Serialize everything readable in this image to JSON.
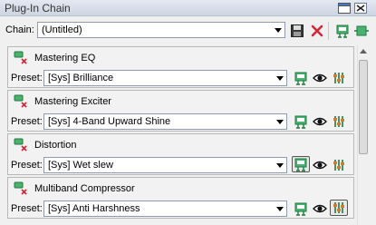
{
  "window": {
    "title": "Plug-In Chain"
  },
  "chain": {
    "label": "Chain:",
    "value": "(Untitled)"
  },
  "plugins": [
    {
      "name": "Mastering EQ",
      "preset_label": "Preset:",
      "preset": "[Sys] Brilliance"
    },
    {
      "name": "Mastering Exciter",
      "preset_label": "Preset:",
      "preset": "[Sys] 4-Band Upward Shine"
    },
    {
      "name": "Distortion",
      "preset_label": "Preset:",
      "preset": "[Sys] Wet slew"
    },
    {
      "name": "Multiband Compressor",
      "preset_label": "Preset:",
      "preset": "[Sys] Anti Harshness"
    }
  ],
  "colors": {
    "accent_green": "#2e9b56",
    "delete_red": "#d2283a"
  }
}
